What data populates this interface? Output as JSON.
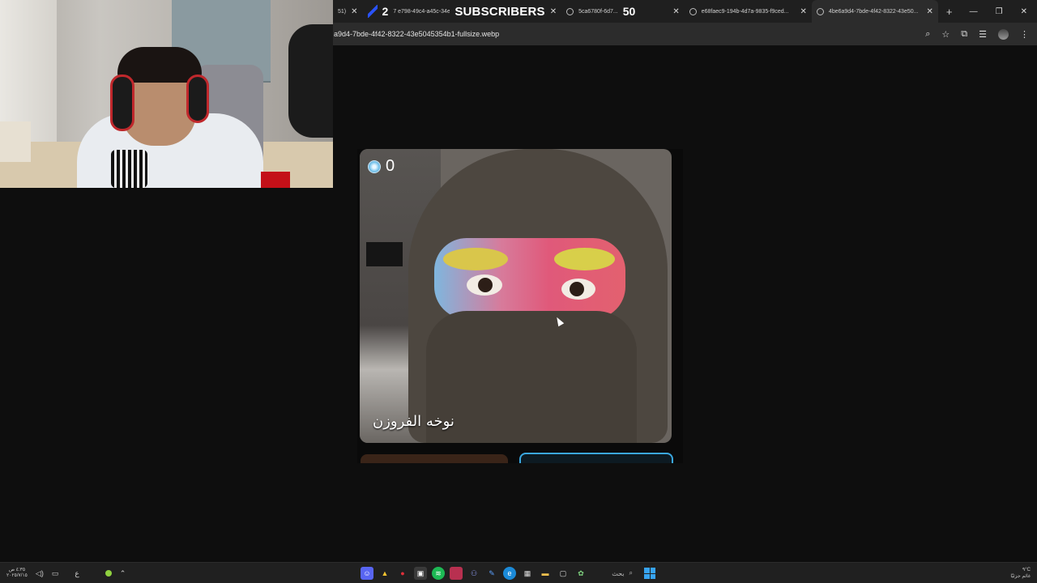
{
  "browser": {
    "tabs": [
      {
        "label": "51)"
      },
      {
        "label": "7 e798-49c4-a45c-34e72..."
      },
      {
        "label": "5ca6780f-6d7..."
      },
      {
        "label": "e68faec9-194b-4d7a-9835-f9ced..."
      },
      {
        "label": "4be6a9d4-7bde-4f42-8322-43e50...",
        "active": true
      }
    ],
    "url": "a9d4-7bde-4f42-8322-43e5045354b1-fullsize.webp",
    "new_tab_label": "+"
  },
  "stream_overlay": {
    "count_left": "2",
    "subscribers_label": "SUBSCRIBERS",
    "count_right": "50"
  },
  "image": {
    "coin_count": "0",
    "caption": "نوخه الفروزن"
  },
  "taskbar": {
    "clock_time": "٤:٣٥ ص",
    "clock_date": "٢٠٢٥/٧/١٥",
    "search_label": "بحث",
    "weather_temp": "٩°C",
    "weather_text": "غائم جزئيًا",
    "lang": "ع"
  },
  "icons": {
    "close": "close-icon",
    "globe": "globe-icon",
    "zoom": "zoom-icon",
    "star": "star-icon",
    "extensions": "extensions-icon",
    "profile": "profile-icon",
    "menu": "menu-icon"
  },
  "colors": {
    "accent_blue": "#3aa7e0",
    "window_bg": "#0e0e0e",
    "tab_bar": "#1f1f1f"
  }
}
